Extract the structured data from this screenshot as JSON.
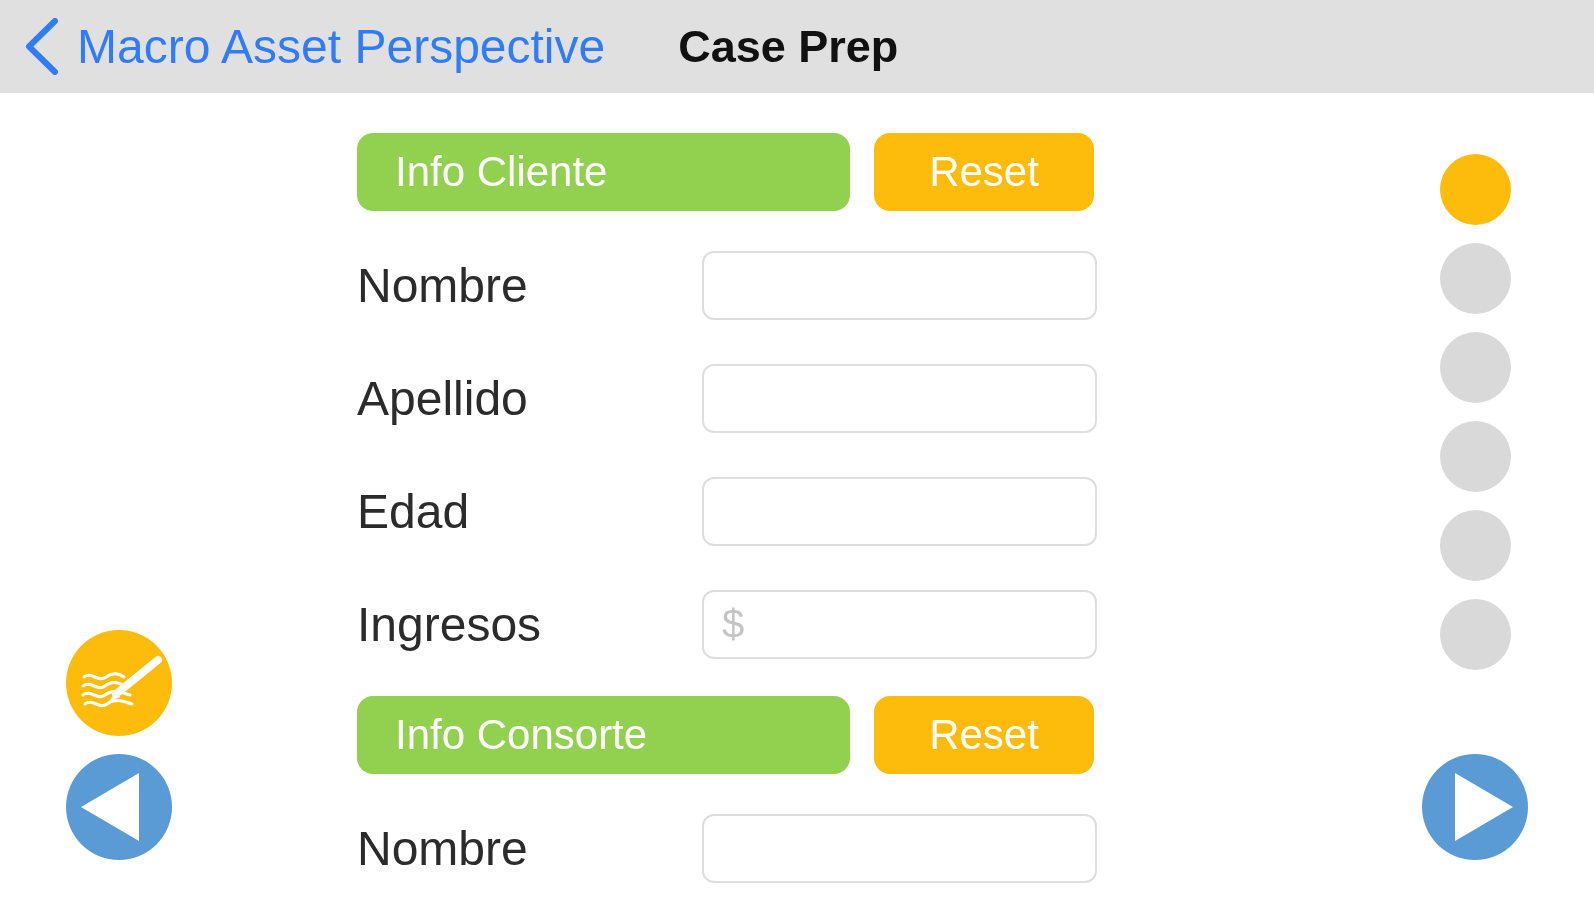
{
  "navigation_bar": {
    "back_label": "Macro Asset Perspective",
    "title": "Case Prep"
  },
  "sections": [
    {
      "title": "Info Cliente",
      "reset_label": "Reset",
      "fields": [
        {
          "label": "Nombre"
        },
        {
          "label": "Apellido"
        },
        {
          "label": "Edad"
        },
        {
          "label": "Ingresos",
          "placeholder": "$"
        }
      ]
    },
    {
      "title": "Info Consorte",
      "reset_label": "Reset",
      "fields": [
        {
          "label": "Nombre"
        }
      ]
    }
  ],
  "page_dots": [
    {
      "selected": true
    },
    {
      "selected": false
    },
    {
      "selected": false
    },
    {
      "selected": false
    },
    {
      "selected": false
    },
    {
      "selected": false
    }
  ]
}
